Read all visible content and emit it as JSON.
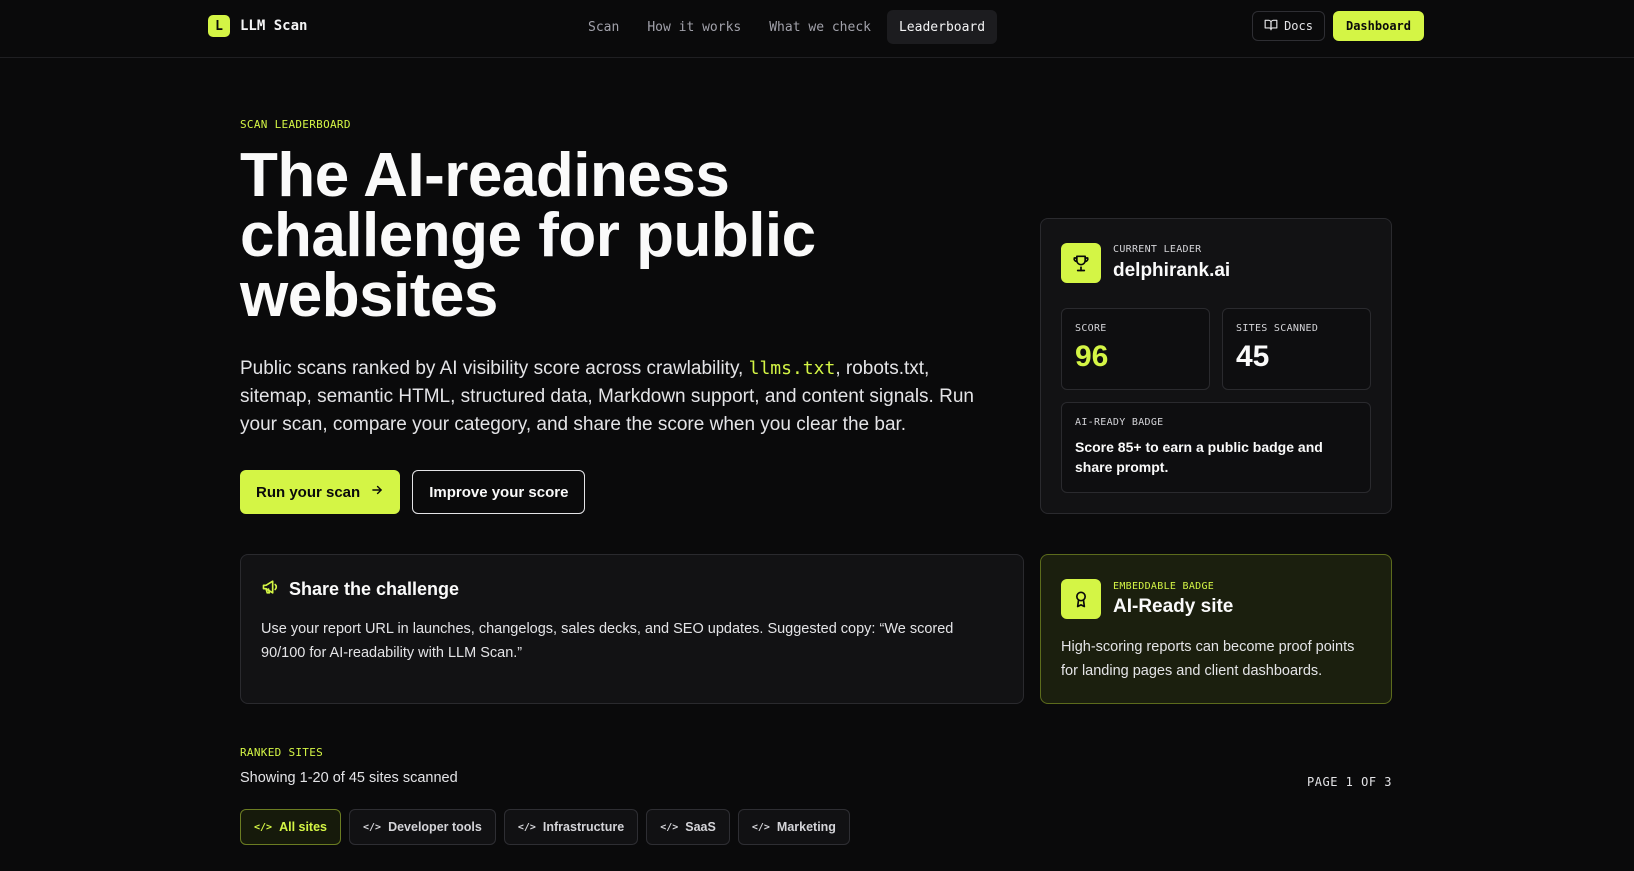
{
  "nav": {
    "logo_mark": "L",
    "logo_text": "LLM Scan",
    "links": [
      "Scan",
      "How it works",
      "What we check",
      "Leaderboard"
    ],
    "docs_label": "Docs",
    "dashboard_label": "Dashboard"
  },
  "hero": {
    "eyebrow": "SCAN LEADERBOARD",
    "title": "The AI-readiness challenge for public websites",
    "desc_before": "Public scans ranked by AI visibility score across crawlability, ",
    "desc_code": "llms.txt",
    "desc_after": ", robots.txt, sitemap, semantic HTML, structured data, Markdown support, and content signals. Run your scan, compare your category, and share the score when you clear the bar.",
    "primary_cta": "Run your scan",
    "secondary_cta": "Improve your score"
  },
  "leader": {
    "label": "CURRENT LEADER",
    "name": "delphirank.ai",
    "score_label": "SCORE",
    "score_value": "96",
    "sites_label": "SITES SCANNED",
    "sites_value": "45",
    "badge_label": "AI-READY BADGE",
    "badge_text": "Score 85+ to earn a public badge and share prompt."
  },
  "share": {
    "title": "Share the challenge",
    "text": "Use your report URL in launches, changelogs, sales decks, and SEO updates. Suggested copy: “We scored 90/100 for AI-readability with LLM Scan.”"
  },
  "embed": {
    "eyebrow": "EMBEDDABLE BADGE",
    "title": "AI-Ready site",
    "text": "High-scoring reports can become proof points for landing pages and client dashboards."
  },
  "ranked": {
    "eyebrow": "RANKED SITES",
    "showing": "Showing 1-20 of 45 sites scanned",
    "pager": "PAGE 1 OF 3",
    "filters": [
      "All sites",
      "Developer tools",
      "Infrastructure",
      "SaaS",
      "Marketing"
    ]
  },
  "colors": {
    "accent": "#d4f545",
    "background": "#0a0a0b",
    "card": "#121214"
  },
  "icons": {
    "trophy": "trophy-icon",
    "megaphone": "megaphone-icon",
    "award": "award-icon",
    "book": "book-icon",
    "arrow": "arrow-right-icon",
    "code": "code-icon"
  }
}
